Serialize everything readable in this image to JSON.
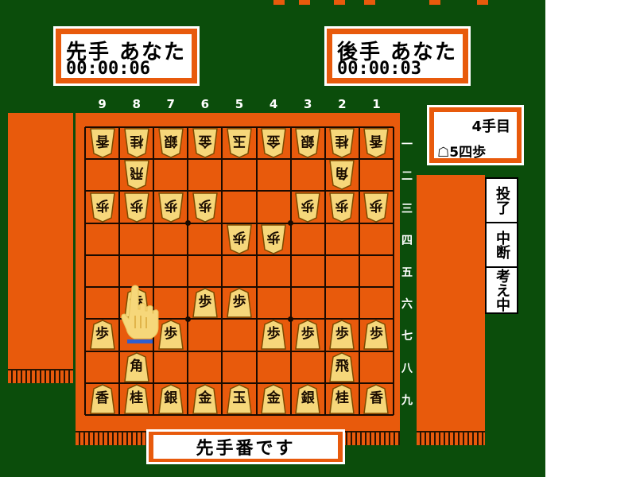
{
  "sente_panel": {
    "label": "先手 あなた",
    "time": "00:00:06"
  },
  "gote_panel": {
    "label": "後手 あなた",
    "time": "00:00:03"
  },
  "move_info": {
    "count": "4手目",
    "last_move": "☖5四歩"
  },
  "menu": {
    "resign": "投了",
    "suspend": "中断",
    "hint": "考え中"
  },
  "status": "先手番です",
  "column_labels": [
    "9",
    "8",
    "7",
    "6",
    "5",
    "4",
    "3",
    "2",
    "1"
  ],
  "row_labels": [
    "一",
    "二",
    "三",
    "四",
    "五",
    "六",
    "七",
    "八",
    "九"
  ],
  "board": {
    "gote_pieces": [
      {
        "file": 9,
        "rank": 1,
        "name": "香"
      },
      {
        "file": 8,
        "rank": 1,
        "name": "桂"
      },
      {
        "file": 7,
        "rank": 1,
        "name": "銀"
      },
      {
        "file": 6,
        "rank": 1,
        "name": "金"
      },
      {
        "file": 5,
        "rank": 1,
        "name": "玉"
      },
      {
        "file": 4,
        "rank": 1,
        "name": "金"
      },
      {
        "file": 3,
        "rank": 1,
        "name": "銀"
      },
      {
        "file": 2,
        "rank": 1,
        "name": "桂"
      },
      {
        "file": 1,
        "rank": 1,
        "name": "香"
      },
      {
        "file": 8,
        "rank": 2,
        "name": "飛"
      },
      {
        "file": 2,
        "rank": 2,
        "name": "角"
      },
      {
        "file": 9,
        "rank": 3,
        "name": "歩"
      },
      {
        "file": 8,
        "rank": 3,
        "name": "歩"
      },
      {
        "file": 7,
        "rank": 3,
        "name": "歩"
      },
      {
        "file": 6,
        "rank": 3,
        "name": "歩"
      },
      {
        "file": 3,
        "rank": 3,
        "name": "歩"
      },
      {
        "file": 2,
        "rank": 3,
        "name": "歩"
      },
      {
        "file": 1,
        "rank": 3,
        "name": "歩"
      },
      {
        "file": 5,
        "rank": 4,
        "name": "歩"
      },
      {
        "file": 4,
        "rank": 4,
        "name": "歩"
      }
    ],
    "sente_pieces": [
      {
        "file": 8,
        "rank": 6,
        "name": "歩"
      },
      {
        "file": 6,
        "rank": 6,
        "name": "歩"
      },
      {
        "file": 5,
        "rank": 6,
        "name": "歩"
      },
      {
        "file": 9,
        "rank": 7,
        "name": "歩"
      },
      {
        "file": 7,
        "rank": 7,
        "name": "歩"
      },
      {
        "file": 4,
        "rank": 7,
        "name": "歩"
      },
      {
        "file": 3,
        "rank": 7,
        "name": "歩"
      },
      {
        "file": 2,
        "rank": 7,
        "name": "歩"
      },
      {
        "file": 1,
        "rank": 7,
        "name": "歩"
      },
      {
        "file": 8,
        "rank": 8,
        "name": "角"
      },
      {
        "file": 2,
        "rank": 8,
        "name": "飛"
      },
      {
        "file": 9,
        "rank": 9,
        "name": "香"
      },
      {
        "file": 8,
        "rank": 9,
        "name": "桂"
      },
      {
        "file": 7,
        "rank": 9,
        "name": "銀"
      },
      {
        "file": 6,
        "rank": 9,
        "name": "金"
      },
      {
        "file": 5,
        "rank": 9,
        "name": "玉"
      },
      {
        "file": 4,
        "rank": 9,
        "name": "金"
      },
      {
        "file": 3,
        "rank": 9,
        "name": "銀"
      },
      {
        "file": 2,
        "rank": 9,
        "name": "桂"
      },
      {
        "file": 1,
        "rank": 9,
        "name": "香"
      }
    ]
  },
  "cursor": {
    "file": 8,
    "rank": 6,
    "icon": "pointing-hand-icon"
  },
  "colors": {
    "background": "#0b4d0b",
    "board": "#e85a0c",
    "piece": "#f6d77a",
    "line": "#1a0a00"
  }
}
